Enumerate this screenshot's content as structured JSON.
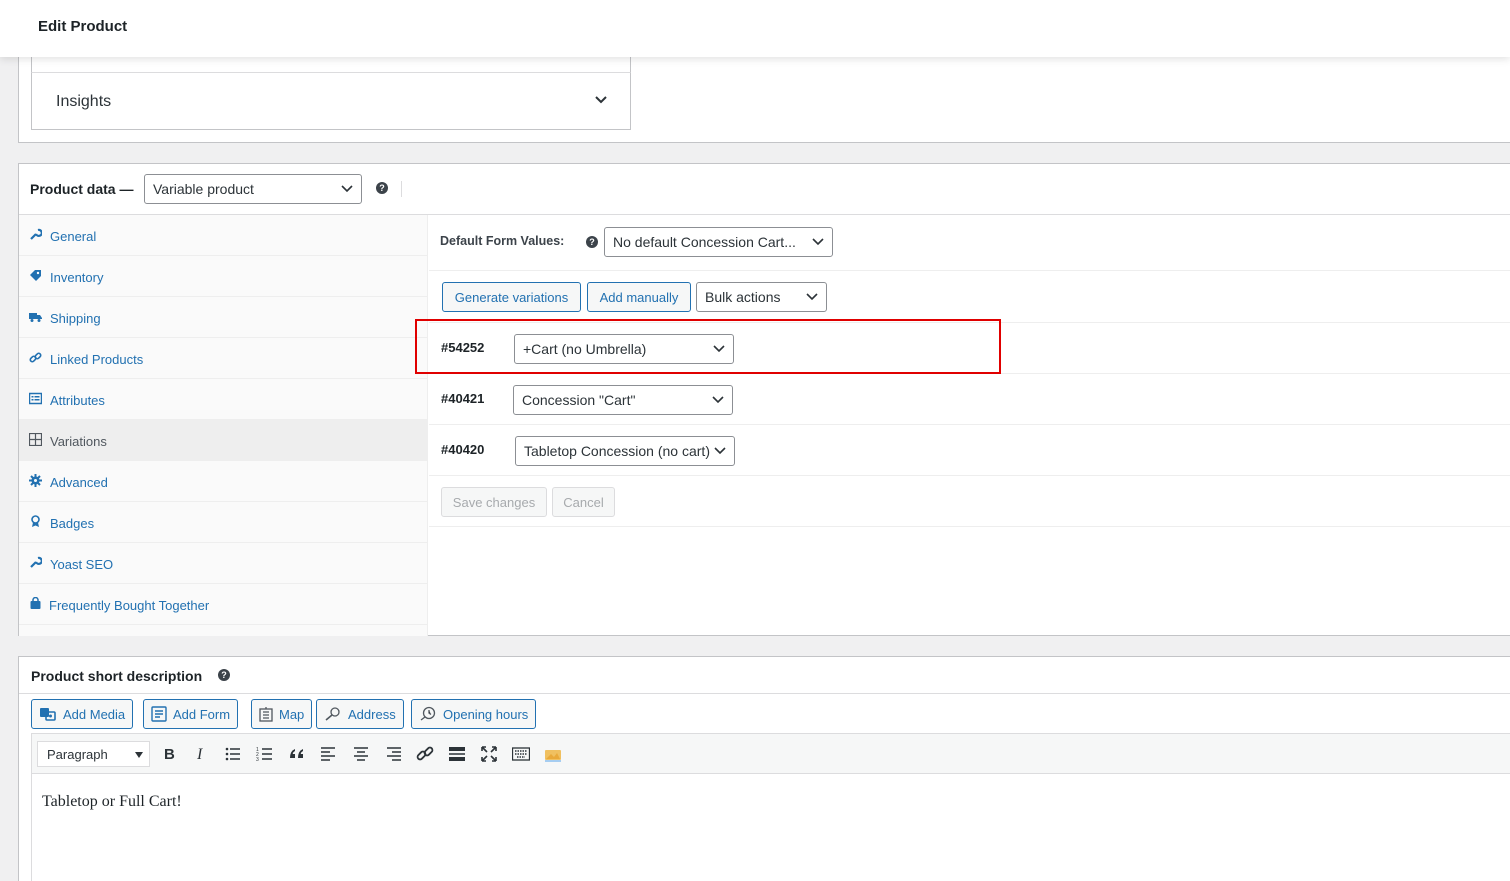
{
  "topbar": {
    "title": "Edit Product"
  },
  "insights": {
    "label": "Insights"
  },
  "product_data": {
    "title": "Product data —",
    "type_select": "Variable product",
    "tabs": [
      {
        "label": "General",
        "icon": "wrench-icon"
      },
      {
        "label": "Inventory",
        "icon": "tag-icon"
      },
      {
        "label": "Shipping",
        "icon": "truck-icon"
      },
      {
        "label": "Linked Products",
        "icon": "link-icon"
      },
      {
        "label": "Attributes",
        "icon": "list-icon"
      },
      {
        "label": "Variations",
        "icon": "grid-icon",
        "active": true
      },
      {
        "label": "Advanced",
        "icon": "gear-icon"
      },
      {
        "label": "Badges",
        "icon": "award-icon"
      },
      {
        "label": "Yoast SEO",
        "icon": "wrench-icon"
      },
      {
        "label": "Frequently Bought Together",
        "icon": "bag-icon"
      }
    ],
    "default_form_values": {
      "label": "Default Form Values:",
      "value": "No default Concession Cart..."
    },
    "actions": {
      "generate": "Generate variations",
      "add_manually": "Add manually",
      "bulk": "Bulk actions"
    },
    "variations": [
      {
        "id": "#54252",
        "value": "+Cart (no Umbrella)"
      },
      {
        "id": "#40421",
        "value": "Concession \"Cart\""
      },
      {
        "id": "#40420",
        "value": "Tabletop Concession (no cart)"
      }
    ],
    "save_label": "Save changes",
    "cancel_label": "Cancel"
  },
  "short_description": {
    "title": "Product short description",
    "media_buttons": [
      "Add Media",
      "Add Form",
      "Map",
      "Address",
      "Opening hours"
    ],
    "format": "Paragraph",
    "content": "Tabletop or Full Cart!"
  },
  "colors": {
    "link": "#2271b1",
    "highlight": "#e00000"
  }
}
